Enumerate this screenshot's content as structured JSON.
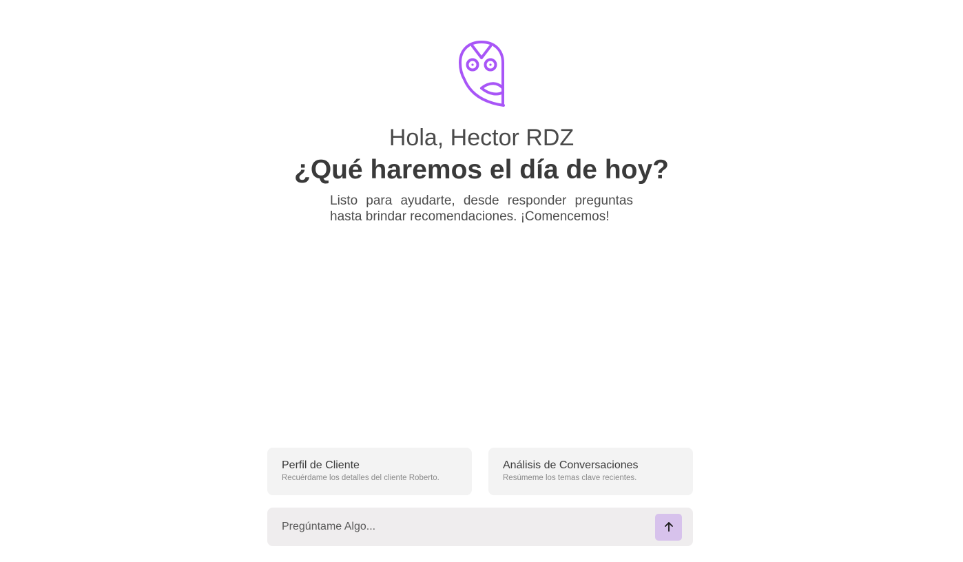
{
  "brand": {
    "logo_icon": "owl-logo-icon",
    "accent_color": "#a855f7"
  },
  "hero": {
    "greeting": "Hola, Hector RDZ",
    "headline": "¿Qué haremos el día de hoy?",
    "subtitle": "Listo para ayudarte, desde responder preguntas hasta brindar recomendaciones. ¡Comencemos!"
  },
  "suggestions": [
    {
      "title": "Perfil de Cliente",
      "description": "Recuérdame los detalles del cliente Roberto."
    },
    {
      "title": "Análisis de Conversaciones",
      "description": "Resúmeme los temas clave recientes."
    }
  ],
  "composer": {
    "placeholder": "Pregúntame Algo...",
    "value": "",
    "send_icon": "arrow-up-icon",
    "send_button_color": "#d7c2ec"
  }
}
